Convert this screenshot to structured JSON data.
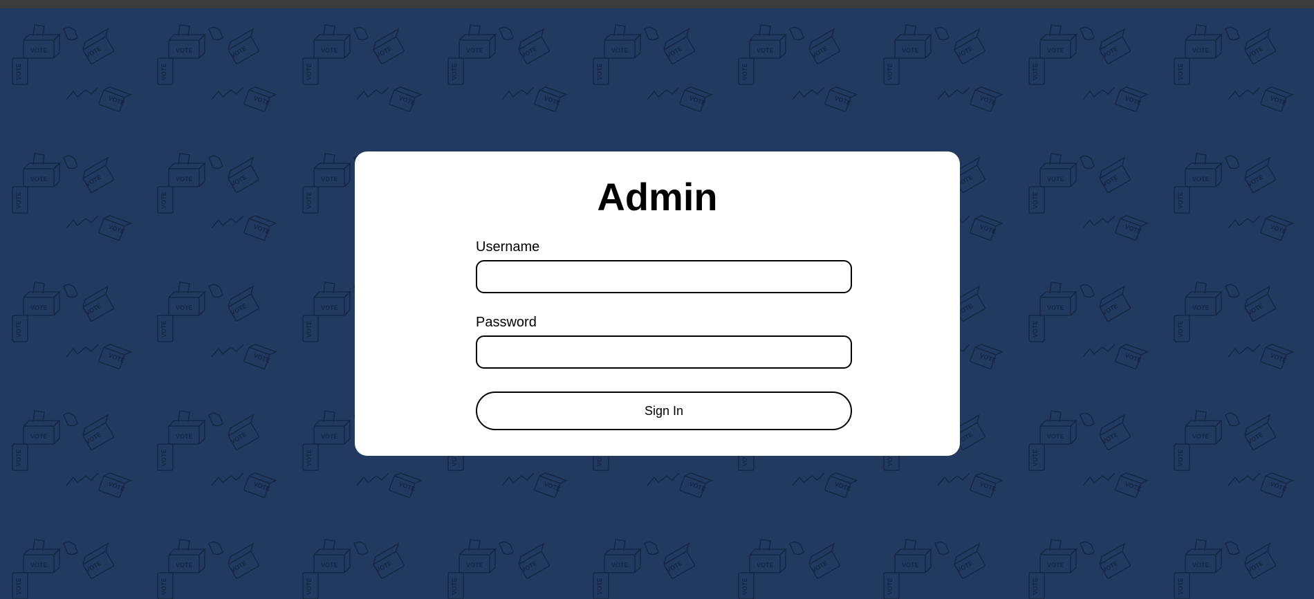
{
  "page": {
    "title": "Admin",
    "background_color": "#223a60",
    "pattern_color": "#0f1f3a",
    "background_icon": "ballot-box-vote-icon",
    "pattern_text": "VOTE"
  },
  "form": {
    "username_label": "Username",
    "username_value": "",
    "password_label": "Password",
    "password_value": "",
    "submit_label": "Sign In"
  }
}
